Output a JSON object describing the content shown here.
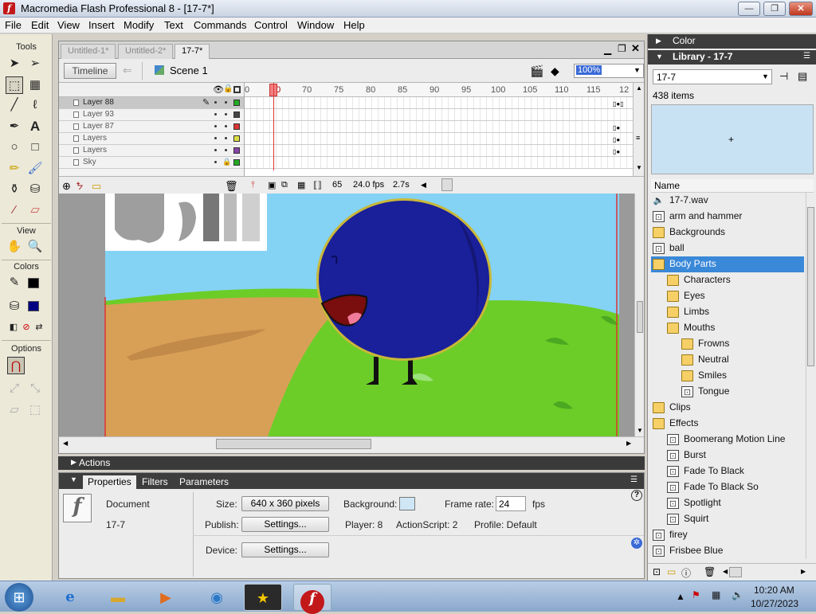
{
  "window": {
    "title": "Macromedia Flash Professional 8 - [17-7*]",
    "min": "—",
    "max": "❐",
    "close": "✕"
  },
  "menu": [
    "File",
    "Edit",
    "View",
    "Insert",
    "Modify",
    "Text",
    "Commands",
    "Control",
    "Window",
    "Help"
  ],
  "tools": {
    "header": "Tools",
    "view_header": "View",
    "colors_header": "Colors",
    "options_header": "Options",
    "stroke_color": "#000000",
    "fill_color": "#000080"
  },
  "doc": {
    "tabs": [
      "Untitled-1*",
      "Untitled-2*",
      "17-7*"
    ],
    "timeline_button": "Timeline",
    "scene": "Scene 1",
    "zoom": "100%",
    "layers": [
      {
        "name": "Layer 88",
        "color": "#22aa22"
      },
      {
        "name": "Layer 93",
        "color": "#444444"
      },
      {
        "name": "Layer 87",
        "color": "#dd3333"
      },
      {
        "name": "Layers",
        "color": "#dddd44"
      },
      {
        "name": "Layers",
        "color": "#8844aa"
      },
      {
        "name": "Sky",
        "color": "#22aa22"
      }
    ],
    "ruler": [
      "60",
      "70",
      "75",
      "80",
      "85",
      "90",
      "95",
      "100",
      "105",
      "110",
      "115",
      "12"
    ],
    "ruler_first": "0",
    "current_frame": "65",
    "fps": "24.0 fps",
    "time": "2.7s"
  },
  "actions": {
    "label": "Actions"
  },
  "properties": {
    "tabs": [
      "Properties",
      "Filters",
      "Parameters"
    ],
    "doc_label": "Document",
    "doc_name": "17-7",
    "size_label": "Size:",
    "size_value": "640 x 360 pixels",
    "background_label": "Background:",
    "background_color": "#cfe6f5",
    "framerate_label": "Frame rate:",
    "framerate_value": "24",
    "fps_unit": "fps",
    "publish_label": "Publish:",
    "settings_label": "Settings...",
    "player": "Player: 8",
    "actionscript": "ActionScript: 2",
    "profile": "Profile: Default",
    "device_label": "Device:",
    "help": "?"
  },
  "color_panel": {
    "title": "Color"
  },
  "library": {
    "title": "Library - 17-7",
    "doc_select": "17-7",
    "count": "438 items",
    "name_header": "Name",
    "items": [
      {
        "label": "17-7.wav",
        "icon": "sound",
        "indent": 0
      },
      {
        "label": "arm and hammer",
        "icon": "symbol",
        "indent": 0
      },
      {
        "label": "Backgrounds",
        "icon": "folder",
        "indent": 0
      },
      {
        "label": "ball",
        "icon": "symbol",
        "indent": 0
      },
      {
        "label": "Body Parts",
        "icon": "folder",
        "indent": 0,
        "selected": true
      },
      {
        "label": "Characters",
        "icon": "folder",
        "indent": 1
      },
      {
        "label": "Eyes",
        "icon": "folder",
        "indent": 1
      },
      {
        "label": "Limbs",
        "icon": "folder",
        "indent": 1
      },
      {
        "label": "Mouths",
        "icon": "folder",
        "indent": 1
      },
      {
        "label": "Frowns",
        "icon": "folder",
        "indent": 2
      },
      {
        "label": "Neutral",
        "icon": "folder",
        "indent": 2
      },
      {
        "label": "Smiles",
        "icon": "folder",
        "indent": 2
      },
      {
        "label": "Tongue",
        "icon": "symbol",
        "indent": 2
      },
      {
        "label": "Clips",
        "icon": "folder",
        "indent": 0
      },
      {
        "label": "Effects",
        "icon": "folder",
        "indent": 0
      },
      {
        "label": "Boomerang Motion Line",
        "icon": "symbol",
        "indent": 1
      },
      {
        "label": "Burst",
        "icon": "symbol",
        "indent": 1
      },
      {
        "label": "Fade To Black",
        "icon": "symbol",
        "indent": 1
      },
      {
        "label": "Fade To Black So",
        "icon": "symbol",
        "indent": 1
      },
      {
        "label": "Spotlight",
        "icon": "symbol",
        "indent": 1
      },
      {
        "label": "Squirt",
        "icon": "symbol",
        "indent": 1
      },
      {
        "label": "firey",
        "icon": "symbol",
        "indent": 0
      },
      {
        "label": "Frisbee Blue",
        "icon": "symbol",
        "indent": 0
      }
    ]
  },
  "taskbar": {
    "time": "10:20 AM",
    "date": "10/27/2023"
  }
}
